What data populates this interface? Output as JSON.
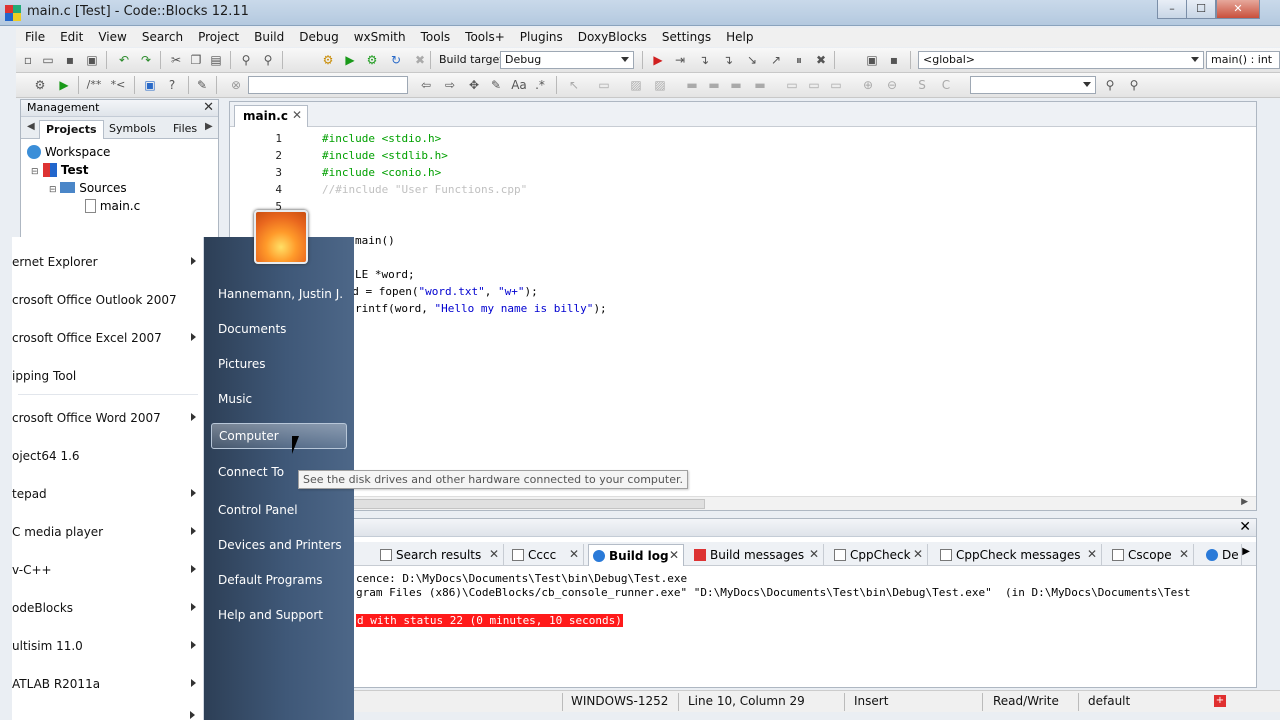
{
  "window": {
    "title": "main.c [Test] - Code::Blocks 12.11",
    "min": "–",
    "max": "☐",
    "close": "✕"
  },
  "menu": [
    "File",
    "Edit",
    "View",
    "Search",
    "Project",
    "Build",
    "Debug",
    "wxSmith",
    "Tools",
    "Tools+",
    "Plugins",
    "DoxyBlocks",
    "Settings",
    "Help"
  ],
  "toolbar": {
    "build_target_label": "Build target:",
    "build_target_value": "Debug",
    "scope_value": "<global>",
    "function_value": "main() : int"
  },
  "management": {
    "title": "Management",
    "tabs": [
      "Projects",
      "Symbols",
      "Files"
    ],
    "tree": {
      "workspace": "Workspace",
      "project": "Test",
      "folder": "Sources",
      "file": "main.c"
    }
  },
  "editor": {
    "tab": "main.c",
    "line_numbers": [
      "1",
      "2",
      "3",
      "4",
      "5"
    ],
    "lines": {
      "l1": "#include <stdio.h>",
      "l2": "#include <stdlib.h>",
      "l3": "#include <conio.h>",
      "l4": "//#include \"User Functions.cpp\"",
      "l7a": "main()",
      "l9a": "LE *word;",
      "l10a": "ord = fopen(",
      "l10b": "\"word.txt\"",
      "l10c": ", ",
      "l10d": "\"w+\"",
      "l10e": ");",
      "l11a": "rintf(word, ",
      "l11b": "\"Hello my name is billy\"",
      "l11c": ");"
    }
  },
  "tooltip": "See the disk drives and other hardware connected to your computer.",
  "logs": {
    "tabs": [
      "Search results",
      "Cccc",
      "Build log",
      "Build messages",
      "CppCheck",
      "CppCheck messages",
      "Cscope",
      "De"
    ],
    "active_tab": "Build log",
    "line1": "cence: D:\\MyDocs\\Documents\\Test\\bin\\Debug\\Test.exe",
    "line2": "gram Files (x86)\\CodeBlocks/cb_console_runner.exe\" \"D:\\MyDocs\\Documents\\Test\\bin\\Debug\\Test.exe\"  (in D:\\MyDocs\\Documents\\Test",
    "error": "d with status 22 (0 minutes, 10 seconds)"
  },
  "status": {
    "encoding": "WINDOWS-1252",
    "position": "Line 10, Column 29",
    "mode": "Insert",
    "access": "Read/Write",
    "lang": "default"
  },
  "start_menu": {
    "left_items": [
      {
        "label": "ernet Explorer",
        "arrow": true
      },
      {
        "label": "crosoft Office Outlook 2007",
        "arrow": false
      },
      {
        "label": "crosoft Office Excel 2007",
        "arrow": true
      },
      {
        "label": "ipping Tool",
        "arrow": false
      },
      {
        "label": "crosoft Office Word 2007",
        "arrow": true
      },
      {
        "label": "oject64 1.6",
        "arrow": false
      },
      {
        "label": "tepad",
        "arrow": true
      },
      {
        "label": "C media player",
        "arrow": true
      },
      {
        "label": "v-C++",
        "arrow": true
      },
      {
        "label": "odeBlocks",
        "arrow": true
      },
      {
        "label": "ultisim 11.0",
        "arrow": true
      },
      {
        "label": "ATLAB R2011a",
        "arrow": true
      }
    ],
    "right_items": [
      "Hannemann, Justin J.",
      "Documents",
      "Pictures",
      "Music",
      "Computer",
      "Connect To",
      "Control Panel",
      "Devices and Printers",
      "Default Programs",
      "Help and Support"
    ],
    "hover_item": "Computer"
  }
}
